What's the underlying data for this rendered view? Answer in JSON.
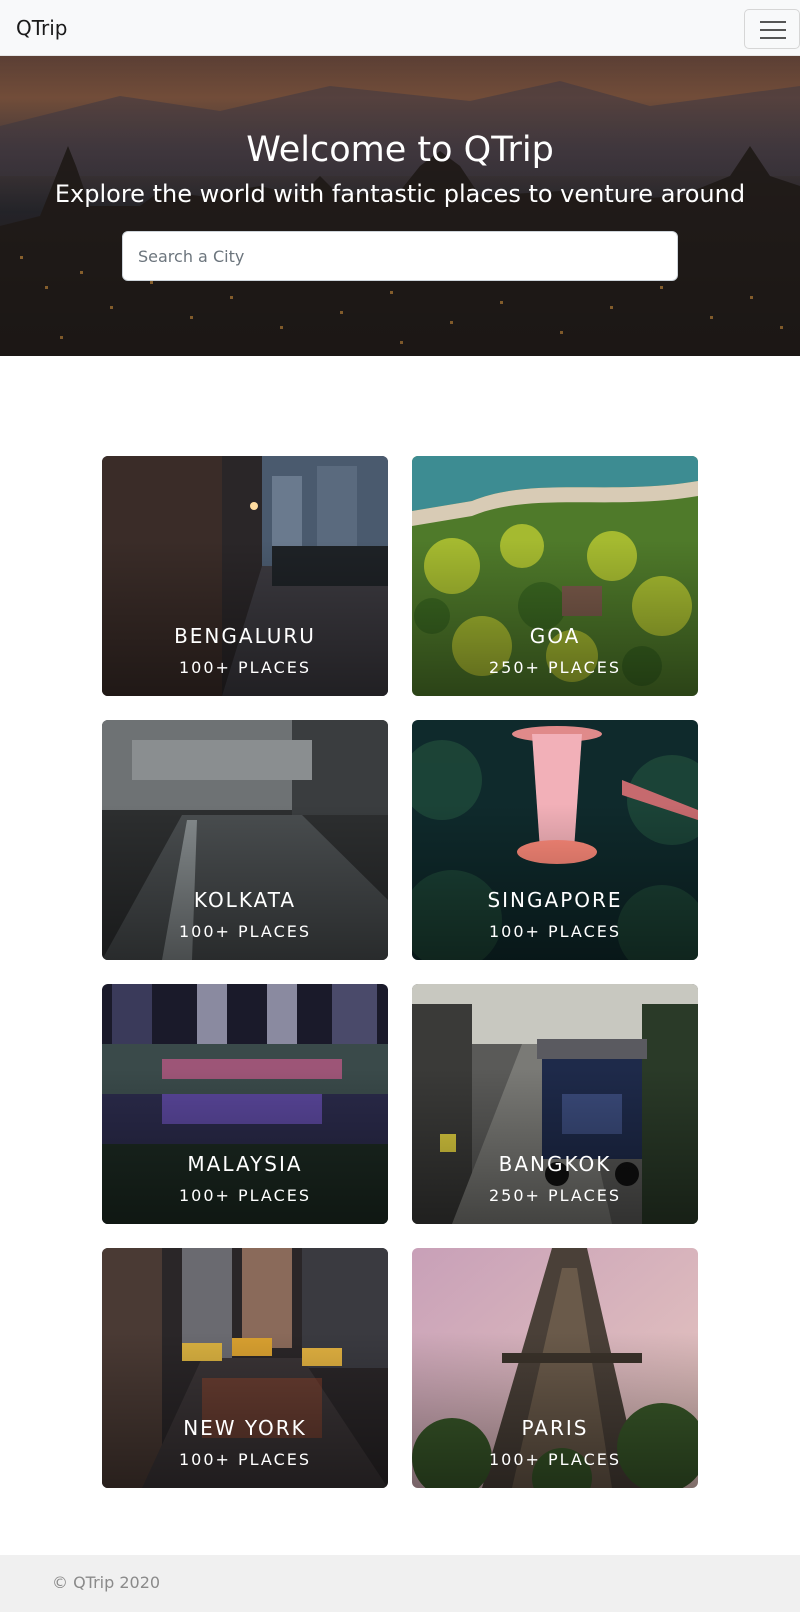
{
  "navbar": {
    "brand": "QTrip",
    "menu_icon": "hamburger-menu-icon"
  },
  "hero": {
    "title": "Welcome to QTrip",
    "subtitle": "Explore the world with fantastic places to venture around",
    "search_placeholder": "Search a City"
  },
  "cities": [
    {
      "name": "BENGALURU",
      "places": "100+ PLACES"
    },
    {
      "name": "GOA",
      "places": "250+ PLACES"
    },
    {
      "name": "KOLKATA",
      "places": "100+ PLACES"
    },
    {
      "name": "SINGAPORE",
      "places": "100+ PLACES"
    },
    {
      "name": "MALAYSIA",
      "places": "100+ PLACES"
    },
    {
      "name": "BANGKOK",
      "places": "250+ PLACES"
    },
    {
      "name": "NEW YORK",
      "places": "100+ PLACES"
    },
    {
      "name": "PARIS",
      "places": "100+ PLACES"
    }
  ],
  "footer": {
    "copyright": "© QTrip 2020"
  }
}
